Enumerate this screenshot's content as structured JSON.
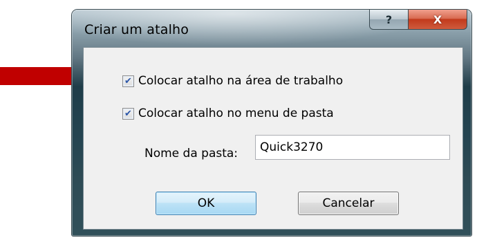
{
  "dialog": {
    "title": "Criar um atalho",
    "help_glyph": "?",
    "close_glyph": "X"
  },
  "options": {
    "desktop_shortcut": {
      "label": "Colocar atalho na área de trabalho",
      "checked": true
    },
    "folder_menu_shortcut": {
      "label": "Colocar atalho no menu de pasta",
      "checked": true
    }
  },
  "folder_name": {
    "label": "Nome da pasta:",
    "value": "Quick3270"
  },
  "buttons": {
    "ok_label": "OK",
    "cancel_label": "Cancelar"
  },
  "colors": {
    "annotation_arrow": "#c00000"
  }
}
